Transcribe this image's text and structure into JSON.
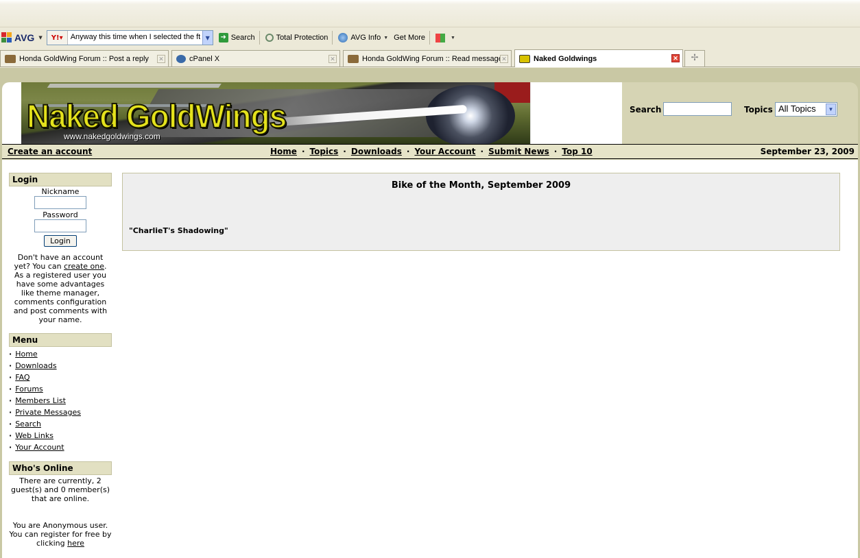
{
  "toolbar": {
    "avg_label": "AVG",
    "search_value": "Anyway this time when I selected the ft",
    "search_label": "Search",
    "total_protection": "Total Protection",
    "avg_info": "AVG Info",
    "get_more": "Get More"
  },
  "tabs": [
    {
      "label": "Honda GoldWing Forum :: Post a reply",
      "icon": "motorbike-icon"
    },
    {
      "label": "cPanel X",
      "icon": "cpanel-icon"
    },
    {
      "label": "Honda GoldWing Forum :: Read message",
      "icon": "motorbike-icon"
    },
    {
      "label": "Naked Goldwings",
      "icon": "ngw-icon",
      "active": true
    }
  ],
  "header": {
    "logo_title": "Naked GoldWings",
    "logo_url": "www.nakedgoldwings.com",
    "search_label": "Search",
    "topics_label": "Topics",
    "topics_selected": "All Topics"
  },
  "nav": {
    "create_account": "Create an account",
    "links": [
      "Home",
      "Topics",
      "Downloads",
      "Your Account",
      "Submit News",
      "Top 10"
    ],
    "separator": "·",
    "date": "September 23, 2009"
  },
  "login": {
    "title": "Login",
    "nickname_label": "Nickname",
    "password_label": "Password",
    "button": "Login",
    "text_before": "Don't have an account yet? You can ",
    "link": "create one",
    "text_after": ". As a registered user you have some advantages like theme manager, comments configuration and post comments with your name."
  },
  "menu": {
    "title": "Menu",
    "items": [
      "Home",
      "Downloads",
      "FAQ",
      "Forums",
      "Members List",
      "Private Messages",
      "Search",
      "Web Links",
      "Your Account"
    ]
  },
  "online": {
    "title": "Who's Online",
    "text": "There are currently, 2 guest(s) and 0 member(s) that are online.",
    "anon_before": "You are Anonymous user. You can register for free by clicking ",
    "anon_link": "here"
  },
  "main": {
    "title": "Bike of the Month, September 2009",
    "body": "\"CharlieT's Shadowing\""
  },
  "colors": {
    "chrome": "#ece9d8",
    "page_bg": "#c9c8a4",
    "block_title_bg": "#e2e0c2",
    "main_box_bg": "#eeeeee"
  }
}
